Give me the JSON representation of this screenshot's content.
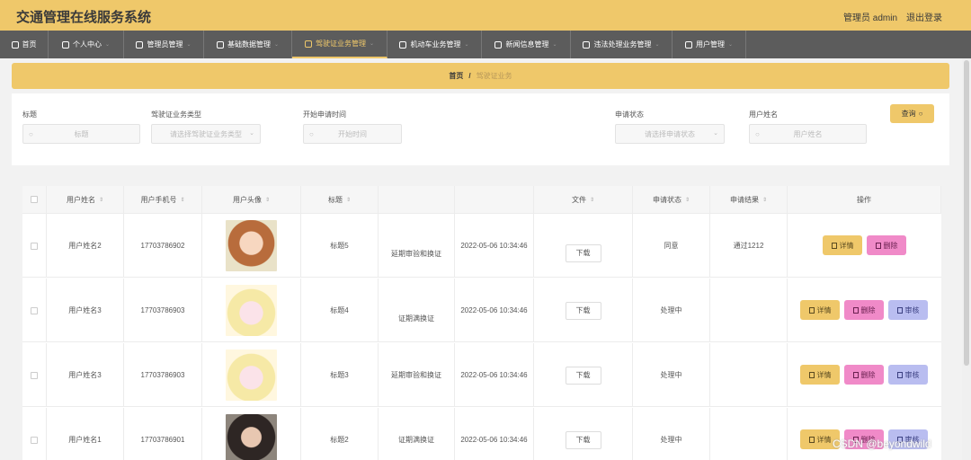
{
  "header": {
    "title": "交通管理在线服务系统",
    "admin": "管理员 admin",
    "logout": "退出登录"
  },
  "nav": [
    {
      "label": "首页",
      "caret": ""
    },
    {
      "label": "个人中心",
      "caret": "⌄"
    },
    {
      "label": "管理员管理",
      "caret": "⌄"
    },
    {
      "label": "基础数据管理",
      "caret": "⌄"
    },
    {
      "label": "驾驶证业务管理",
      "caret": "⌄"
    },
    {
      "label": "机动车业务管理",
      "caret": "⌄"
    },
    {
      "label": "新闻信息管理",
      "caret": "⌄"
    },
    {
      "label": "违法处理业务管理",
      "caret": "⌄"
    },
    {
      "label": "用户管理",
      "caret": "⌄"
    }
  ],
  "breadcrumb": {
    "home": "首页",
    "sep": "/",
    "current": "驾驶证业务"
  },
  "search": {
    "title_label": "标题",
    "title_placeholder": "标题",
    "type_label": "驾驶证业务类型",
    "type_placeholder": "请选择驾驶证业务类型",
    "time_label": "开始申请时间",
    "time_placeholder": "开始时间",
    "status_label": "申请状态",
    "status_placeholder": "请选择申请状态",
    "user_label": "用户姓名",
    "user_placeholder": "用户姓名",
    "query_label": "查询",
    "search_glyph": "○",
    "caret_glyph": "⌄"
  },
  "table": {
    "headers": [
      "用户姓名",
      "用户手机号",
      "用户头像",
      "标题",
      "文件",
      "申请状态",
      "申请结果",
      "操作"
    ],
    "sort_glyph": "⇕",
    "download": "下载",
    "detail": "详情",
    "delete": "删除",
    "audit": "审核",
    "rows": [
      {
        "name": "用户姓名2",
        "phone": "17703786902",
        "title": "标题5",
        "type": "延期审验和换证",
        "time": "2022-05-06 10:34:46",
        "status": "同意",
        "result": "通过1212"
      },
      {
        "name": "用户姓名3",
        "phone": "17703786903",
        "title": "标题4",
        "type": "证期满换证",
        "time": "2022-05-06 10:34:46",
        "status": "处理中",
        "result": ""
      },
      {
        "name": "用户姓名3",
        "phone": "17703786903",
        "title": "标题3",
        "type": "延期审验和换证",
        "time": "2022-05-06 10:34:46",
        "status": "处理中",
        "result": ""
      },
      {
        "name": "用户姓名1",
        "phone": "17703786901",
        "title": "标题2",
        "type": "证期满换证",
        "time": "2022-05-06 10:34:46",
        "status": "处理中",
        "result": ""
      }
    ]
  },
  "watermark": "CSDN @beyondwild"
}
